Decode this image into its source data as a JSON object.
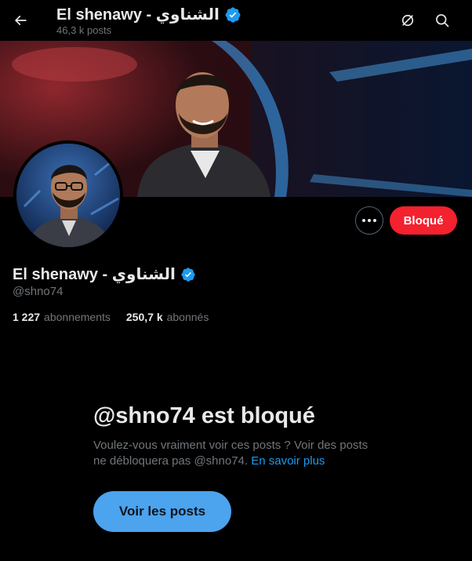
{
  "header": {
    "title": "El shenawy - الشناوي",
    "posts_count": "46,3 k posts",
    "icons": [
      "back-arrow-icon",
      "verified-badge-icon",
      "grok-icon",
      "search-icon"
    ]
  },
  "profile": {
    "name": "El shenawy - الشناوي",
    "handle": "@shno74",
    "blocked_button": "Bloqué",
    "following_count": "1 227",
    "following_label": "abonnements",
    "followers_count": "250,7 k",
    "followers_label": "abonnés"
  },
  "blocked_notice": {
    "title": "@shno74 est bloqué",
    "description": "Voulez-vous vraiment voir ces posts ? Voir des posts ne débloquera pas @shno74.",
    "learn_more": "En savoir plus",
    "view_posts_button": "Voir les posts"
  },
  "colors": {
    "background": "#000000",
    "text_primary": "#e7e9ea",
    "text_secondary": "#71767b",
    "accent_blue": "#1d9bf0",
    "verified_blue": "#1d9bf0",
    "blocked_red": "#f4212e",
    "button_blue": "#4ca3ee"
  }
}
